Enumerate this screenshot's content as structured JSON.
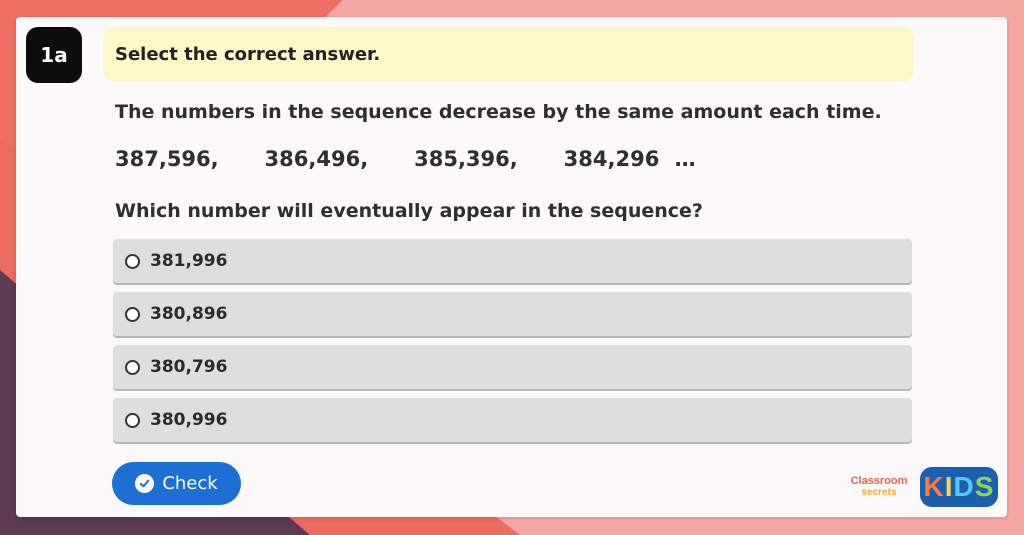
{
  "question": {
    "number": "1a",
    "instruction": "Select the correct answer.",
    "statement": "The numbers in the sequence decrease by the same amount each time.",
    "sequence": "387,596,   386,496,   385,396,   384,296 …",
    "prompt": "Which number will eventually appear in the sequence?"
  },
  "options": [
    {
      "label": "381,996"
    },
    {
      "label": "380,896"
    },
    {
      "label": "380,796"
    },
    {
      "label": "380,996"
    }
  ],
  "actions": {
    "check_label": "Check",
    "check_icon": "check-circle-icon"
  },
  "branding": {
    "logo_text_line1": "Classroom",
    "logo_text_line2": "secrets",
    "kids_k": "K",
    "kids_i": "I",
    "kids_d": "D",
    "kids_s": "S"
  },
  "colors": {
    "accent_button": "#1e6fd4",
    "instruction_bg": "#fdf8c8",
    "option_bg": "#dedede",
    "badge_bg": "#0d0d0d"
  }
}
